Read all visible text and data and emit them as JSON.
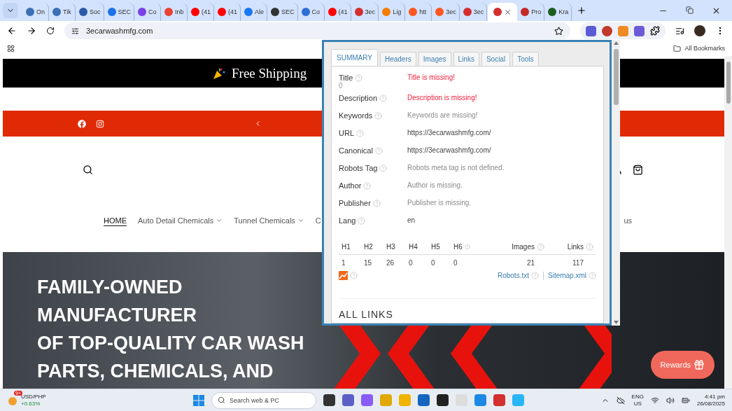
{
  "browser": {
    "tabs": [
      {
        "title": "On",
        "color": "#3b6fb6",
        "selected": false
      },
      {
        "title": "Tik",
        "color": "#3b6fb6",
        "selected": false
      },
      {
        "title": "Soc",
        "color": "#2b5aa8",
        "selected": false
      },
      {
        "title": "SEC",
        "color": "#1a73e8",
        "selected": false
      },
      {
        "title": "Co",
        "color": "#7b3fe4",
        "selected": false
      },
      {
        "title": "Inb",
        "color": "#ea4335",
        "selected": false
      },
      {
        "title": "(41",
        "color": "#ff0000",
        "selected": false
      },
      {
        "title": "(41",
        "color": "#ff0000",
        "selected": false
      },
      {
        "title": "Ale",
        "color": "#1877f2",
        "selected": false
      },
      {
        "title": "SEC",
        "color": "#333333",
        "selected": false
      },
      {
        "title": "Co",
        "color": "#2f6fd6",
        "selected": false
      },
      {
        "title": "(41",
        "color": "#ff0000",
        "selected": false
      },
      {
        "title": "3ec",
        "color": "#d32f2f",
        "selected": false
      },
      {
        "title": "Lig",
        "color": "#f57c00",
        "selected": false
      },
      {
        "title": "htt",
        "color": "#ff5722",
        "selected": false
      },
      {
        "title": "3ec",
        "color": "#ff5722",
        "selected": false
      },
      {
        "title": "3ec",
        "color": "#d32f2f",
        "selected": false
      },
      {
        "color": "#d32f2f",
        "selected": true
      },
      {
        "title": "Pro",
        "color": "#c62828",
        "selected": false
      },
      {
        "title": "Kra",
        "color": "#1b5e20",
        "selected": false
      }
    ],
    "address": "3ecarwashmfg.com",
    "bookmarks_label": "All Bookmarks"
  },
  "page": {
    "banner": "Free Shipping",
    "nav": [
      {
        "label": "HOME",
        "selected": true,
        "dropdown": false
      },
      {
        "label": "Auto Detail Chemicals",
        "selected": false,
        "dropdown": true
      },
      {
        "label": "Tunnel Chemicals",
        "selected": false,
        "dropdown": true
      },
      {
        "label": "C",
        "selected": false,
        "dropdown": false
      }
    ],
    "nav_tail": "us",
    "hero_lines": [
      "FAMILY-OWNED",
      "MANUFACTURER",
      "OF TOP-QUALITY CAR WASH",
      "PARTS, CHEMICALS, AND"
    ],
    "rewards": "Rewards"
  },
  "popup": {
    "tabs": [
      {
        "label": "SUMMARY",
        "selected": true
      },
      {
        "label": "Headers",
        "selected": false
      },
      {
        "label": "Images",
        "selected": false
      },
      {
        "label": "Links",
        "selected": false
      },
      {
        "label": "Social",
        "selected": false
      },
      {
        "label": "Tools",
        "selected": false
      }
    ],
    "rows": [
      {
        "label": "Title",
        "count": "0",
        "value": "Title is missing!",
        "kind": "error"
      },
      {
        "label": "Description",
        "value": "Description is missing!",
        "kind": "error"
      },
      {
        "label": "Keywords",
        "value": "Keywords are missing!",
        "kind": "muted"
      },
      {
        "label": "URL",
        "value": "https://3ecarwashmfg.com/",
        "kind": "normal"
      },
      {
        "label": "Canonical",
        "value": "https://3ecarwashmfg.com/",
        "kind": "normal"
      },
      {
        "label": "Robots Tag",
        "value": "Robots meta tag is not defined.",
        "kind": "muted"
      },
      {
        "label": "Author",
        "value": "Author is missing.",
        "kind": "muted"
      },
      {
        "label": "Publisher",
        "value": "Publisher is missing.",
        "kind": "muted"
      },
      {
        "label": "Lang",
        "value": "en",
        "kind": "normal"
      }
    ],
    "headings": [
      {
        "label": "H1",
        "value": "1",
        "help": false,
        "wide": false
      },
      {
        "label": "H2",
        "value": "15",
        "help": false,
        "wide": false
      },
      {
        "label": "H3",
        "value": "26",
        "help": false,
        "wide": false
      },
      {
        "label": "H4",
        "value": "0",
        "help": false,
        "wide": false
      },
      {
        "label": "H5",
        "value": "0",
        "help": false,
        "wide": false
      },
      {
        "label": "H6",
        "value": "0",
        "help": true,
        "wide": false
      },
      {
        "label": "Images",
        "value": "21",
        "help": true,
        "wide": true
      },
      {
        "label": "Links",
        "value": "117",
        "help": true,
        "wide": true
      }
    ],
    "links": [
      "Robots.txt",
      "Sitemap.xml"
    ],
    "section": "ALL LINKS"
  },
  "taskbar": {
    "widget": {
      "title": "USD/PHP",
      "change": "+0.63%",
      "badge": "9+"
    },
    "search": {
      "placeholder": "Search web & PC"
    },
    "lang": [
      "ENG",
      "US"
    ],
    "time": "4:41 pm",
    "date": "26/08/2025"
  }
}
